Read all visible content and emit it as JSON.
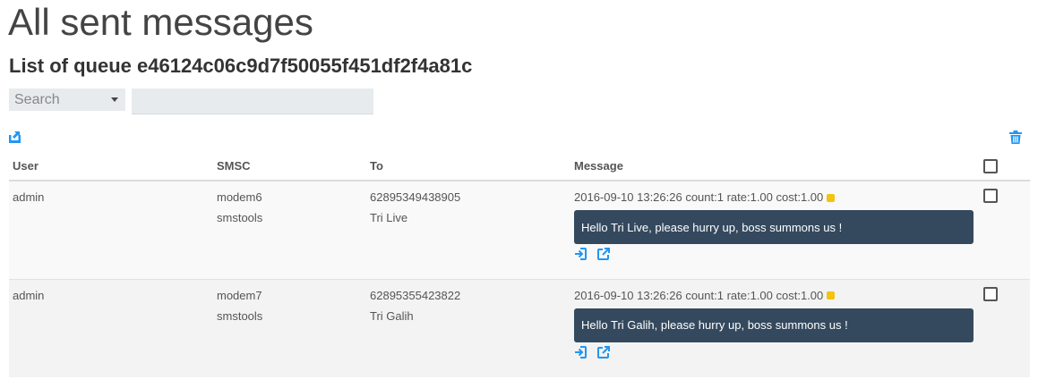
{
  "page": {
    "title": "All sent messages",
    "subtitle": "List of queue e46124c06c9d7f50055f451df2f4a81c"
  },
  "search": {
    "select_label": "Search",
    "input_value": ""
  },
  "icons": {
    "export": "export-icon",
    "trash": "trash-icon",
    "resend": "sign-in-icon",
    "open": "external-link-icon"
  },
  "colors": {
    "accent": "#2196f3",
    "bubble": "#34495e",
    "status_dot": "#f1c40f"
  },
  "table": {
    "headers": {
      "user": "User",
      "smsc": "SMSC",
      "to": "To",
      "message": "Message"
    },
    "rows": [
      {
        "user": "admin",
        "smsc": "modem6",
        "smsc_type": "smstools",
        "to_number": "62895349438905",
        "to_name": "Tri Live",
        "meta": "2016-09-10 13:26:26 count:1 rate:1.00 cost:1.00",
        "message": "Hello Tri Live, please hurry up, boss summons us !"
      },
      {
        "user": "admin",
        "smsc": "modem7",
        "smsc_type": "smstools",
        "to_number": "62895355423822",
        "to_name": "Tri Galih",
        "meta": "2016-09-10 13:26:26 count:1 rate:1.00 cost:1.00",
        "message": "Hello Tri Galih, please hurry up, boss summons us !"
      }
    ]
  }
}
